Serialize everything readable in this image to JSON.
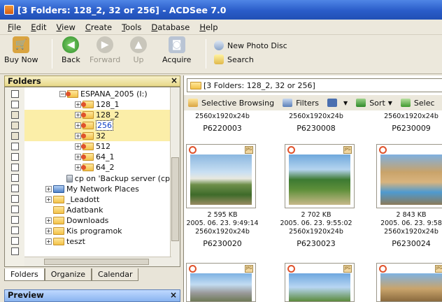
{
  "window": {
    "title": "[3 Folders: 128_2, 32 or 256] - ACDSee 7.0"
  },
  "menu": [
    {
      "u": "F",
      "rest": "ile"
    },
    {
      "u": "E",
      "rest": "dit"
    },
    {
      "u": "V",
      "rest": "iew"
    },
    {
      "u": "C",
      "rest": "reate"
    },
    {
      "u": "T",
      "rest": "ools"
    },
    {
      "u": "D",
      "rest": "atabase"
    },
    {
      "u": "H",
      "rest": "elp"
    }
  ],
  "toolbar": {
    "buy_now": "Buy Now",
    "back": "Back",
    "forward": "Forward",
    "up": "Up",
    "acquire": "Acquire",
    "new_photo_disc": "New Photo Disc",
    "search": "Search"
  },
  "folders_pane": {
    "title": "Folders",
    "close": "×",
    "tree": [
      "ESPANA_2005 (I:)",
      "128_1",
      "128_2",
      "256",
      "32",
      "512",
      "64_1",
      "64_2",
      "cp on 'Backup server (cp",
      "My Network Places",
      "_Leadott",
      "Adatbank",
      "Downloads",
      "Kis programok",
      "teszt"
    ],
    "tabs": [
      "Folders",
      "Organize",
      "Calendar"
    ]
  },
  "preview_pane": {
    "title": "Preview",
    "close": "×"
  },
  "browser": {
    "path": "[3 Folders: 128_2, 32 or 256]",
    "selective_browsing": "Selective Browsing",
    "filters": "Filters",
    "sort": "Sort",
    "select": "Selec"
  },
  "thumbs_top": [
    {
      "res": "2560x1920x24b",
      "name": "P6220003"
    },
    {
      "res": "2560x1920x24b",
      "name": "P6230008"
    },
    {
      "res": "2560x1920x24b",
      "name": "P6230009"
    }
  ],
  "thumbs_mid": [
    {
      "size": "2 595 KB",
      "date": "2005. 06. 23. 9:49:14",
      "res": "2560x1920x24b",
      "name": "P6230020"
    },
    {
      "size": "2 702 KB",
      "date": "2005. 06. 23. 9:55:02",
      "res": "2560x1920x24b",
      "name": "P6230023"
    },
    {
      "size": "2 843 KB",
      "date": "2005. 06. 23. 9:58",
      "res": "2560x1920x24b",
      "name": "P6230024"
    }
  ]
}
